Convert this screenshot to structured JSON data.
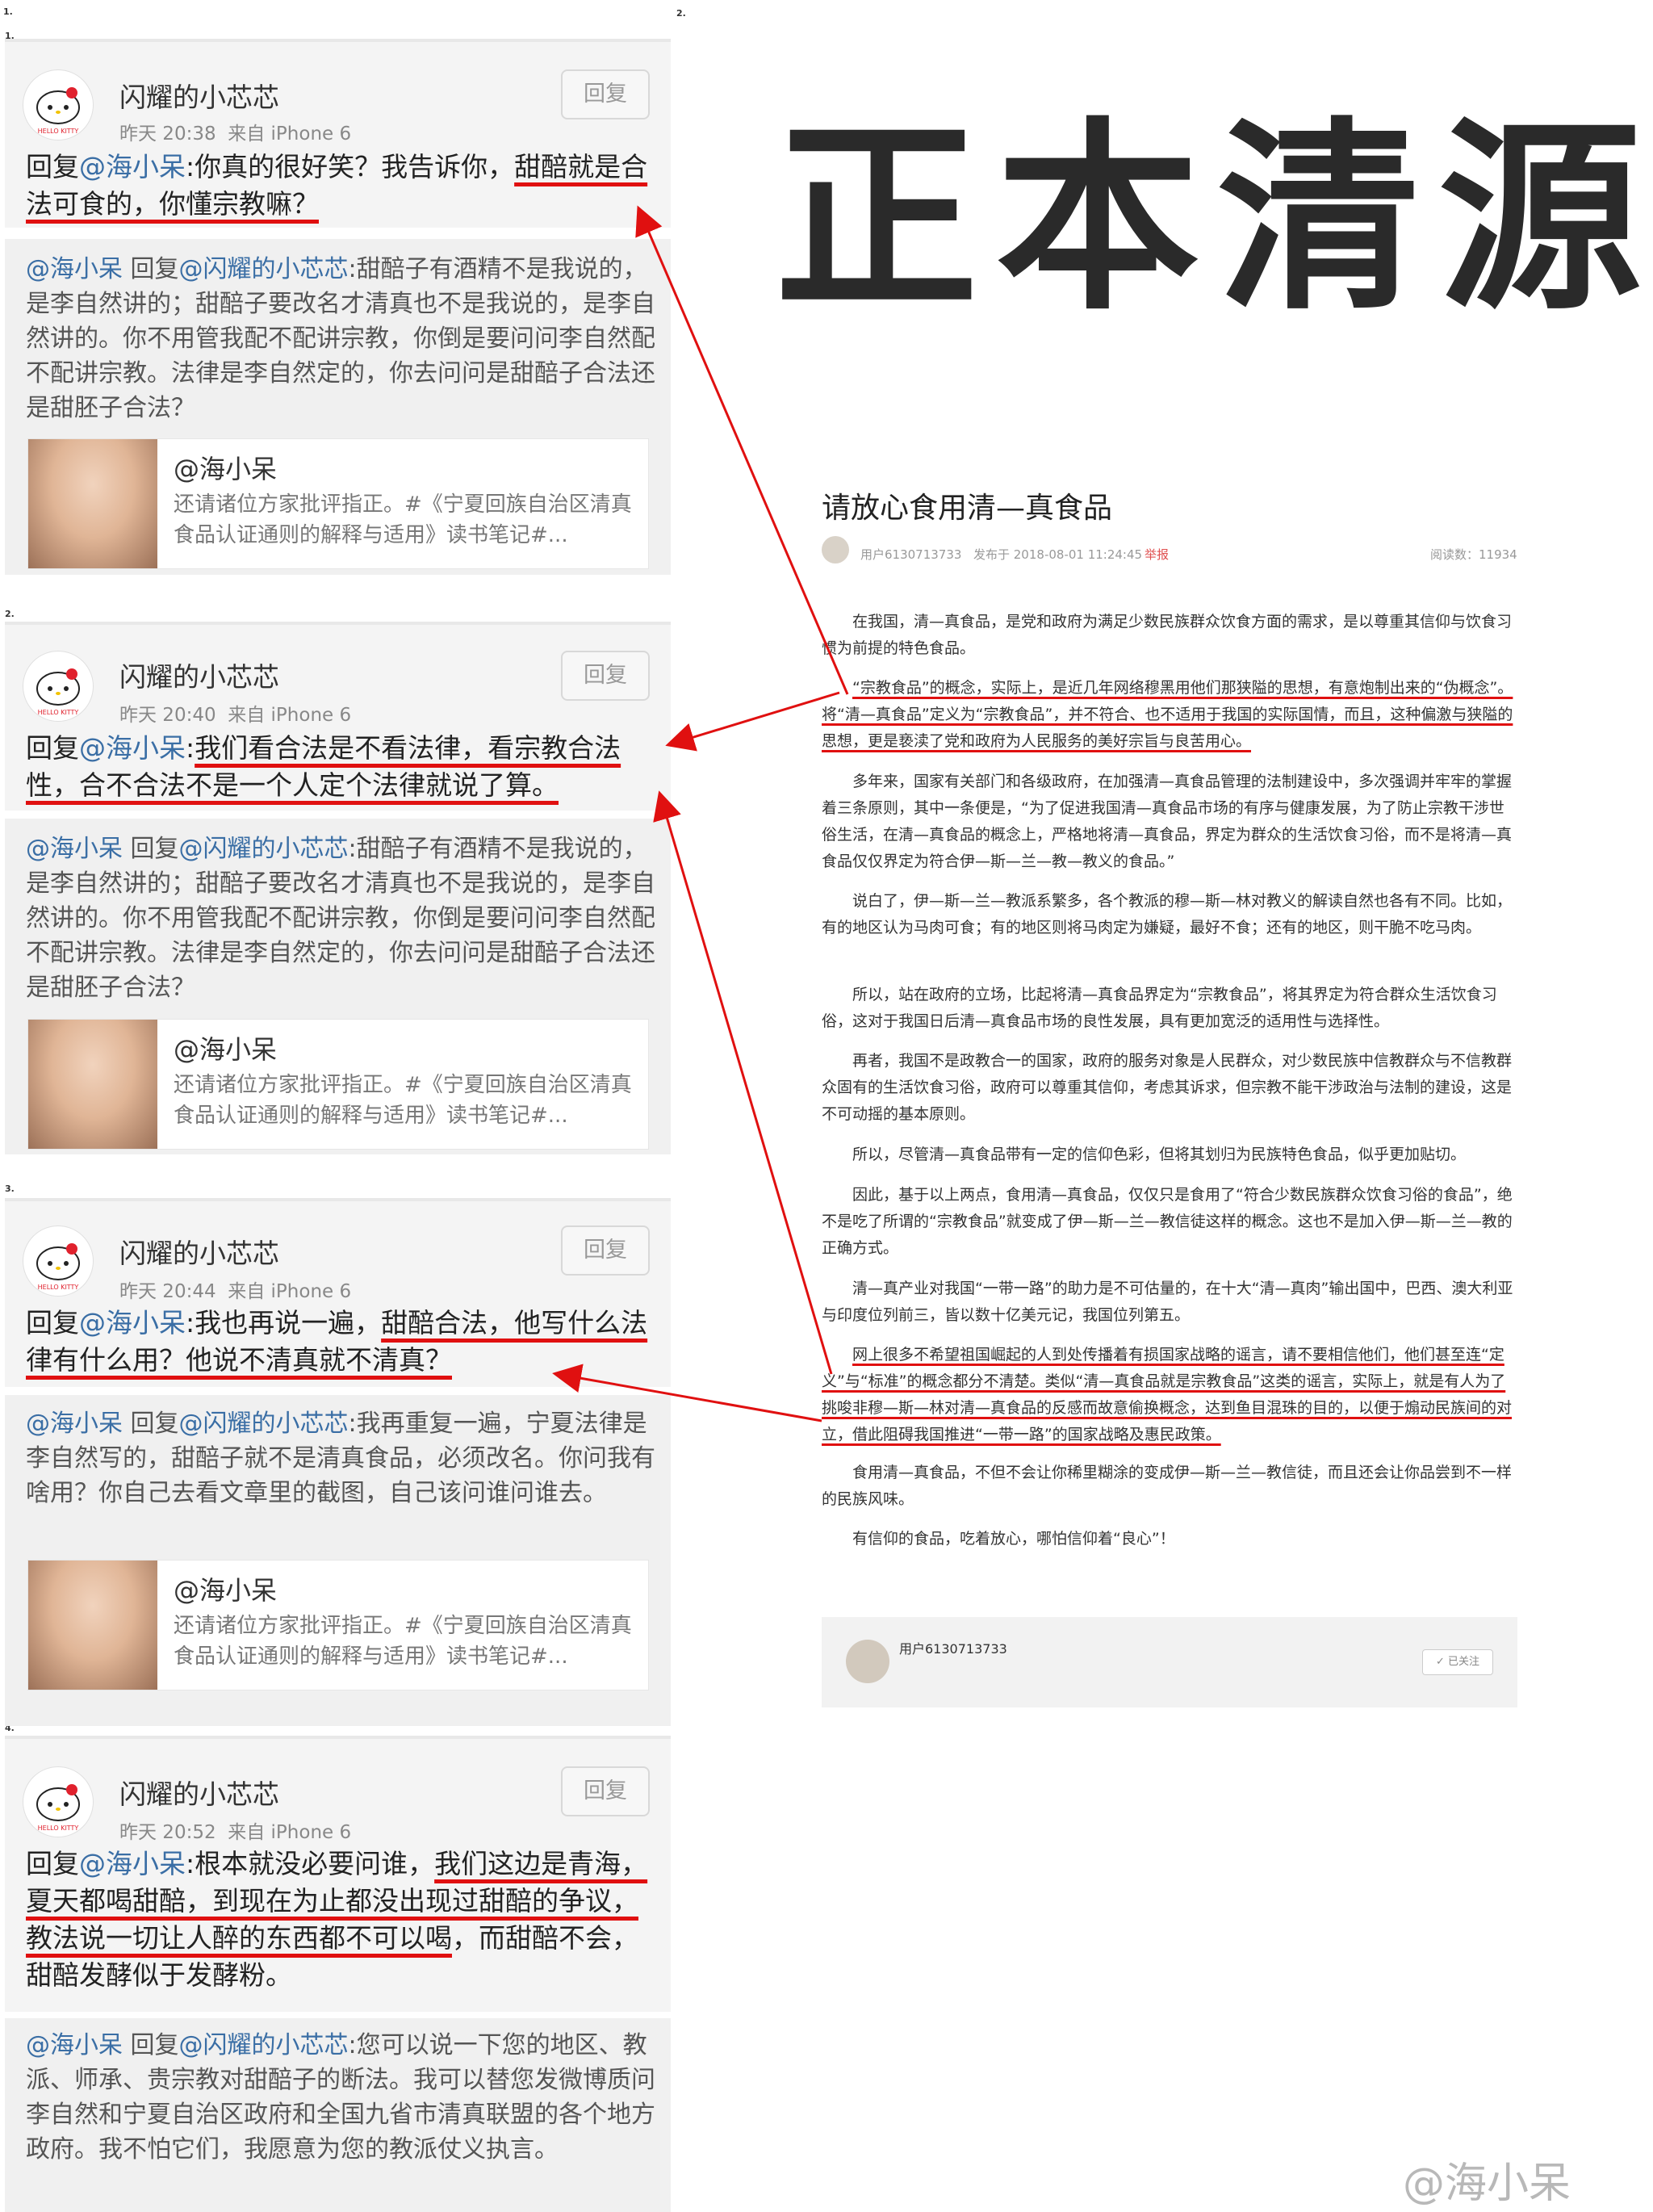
{
  "labels": {
    "n1": "1.",
    "n2": "2.",
    "n1b": "1.",
    "n2b": "2.",
    "n3": "3.",
    "n4": "4."
  },
  "reply_label": "回复",
  "comments": [
    {
      "user": "闪耀的小芯芯",
      "time": "昨天 20:38",
      "source": "来自 iPhone 6",
      "prefix": "回复",
      "mention": "@海小呆",
      "text_a": ":你真的很好笑？我告诉你，",
      "text_u": "甜醅就是合法可食的，你懂宗教嘛？",
      "text_b": "",
      "quote_mention": "@海小呆",
      "quote_reply": " 回复",
      "quote_mention2": "@闪耀的小芯芯",
      "quote_text": ":甜醅子有酒精不是我说的，是李自然讲的；甜醅子要改名才清真也不是我说的，是李自然讲的。你不用管我配不配讲宗教，你倒是要问问李自然配不配讲宗教。法律是李自然定的，你去问问是甜醅子合法还是甜胚子合法？",
      "card_title": "@海小呆",
      "card_desc": "还请诸位方家批评指正。#《宁夏回族自治区清真食品认证通则的解释与适用》读书笔记#..."
    },
    {
      "user": "闪耀的小芯芯",
      "time": "昨天 20:40",
      "source": "来自 iPhone 6",
      "prefix": "回复",
      "mention": "@海小呆",
      "text_a": ":",
      "text_u": "我们看合法是不看法律，看宗教合法性，合不合法不是一个人定个法律就说了算。",
      "text_b": "",
      "quote_mention": "@海小呆",
      "quote_reply": " 回复",
      "quote_mention2": "@闪耀的小芯芯",
      "quote_text": ":甜醅子有酒精不是我说的，是李自然讲的；甜醅子要改名才清真也不是我说的，是李自然讲的。你不用管我配不配讲宗教，你倒是要问问李自然配不配讲宗教。法律是李自然定的，你去问问是甜醅子合法还是甜胚子合法？",
      "card_title": "@海小呆",
      "card_desc": "还请诸位方家批评指正。#《宁夏回族自治区清真食品认证通则的解释与适用》读书笔记#..."
    },
    {
      "user": "闪耀的小芯芯",
      "time": "昨天 20:44",
      "source": "来自 iPhone 6",
      "prefix": "回复",
      "mention": "@海小呆",
      "text_a": ":我也再说一遍，",
      "text_u": "甜醅合法，他写什么法律有什么用？他说不清真就不清真？",
      "text_b": "",
      "quote_mention": "@海小呆",
      "quote_reply": " 回复",
      "quote_mention2": "@闪耀的小芯芯",
      "quote_text": ":我再重复一遍，宁夏法律是李自然写的，甜醅子就不是清真食品，必须改名。你问我有啥用？你自己去看文章里的截图，自己该问谁问谁去。",
      "card_title": "@海小呆",
      "card_desc": "还请诸位方家批评指正。#《宁夏回族自治区清真食品认证通则的解释与适用》读书笔记#..."
    },
    {
      "user": "闪耀的小芯芯",
      "time": "昨天 20:52",
      "source": "来自 iPhone 6",
      "prefix": "回复",
      "mention": "@海小呆",
      "text_a": ":根本就没必要问谁，",
      "text_u": "我们这边是青海，夏天都喝甜醅，到现在为止都没出现过甜醅的争议，教法说一切让人醉的东西都不可以喝",
      "text_b": "，而甜醅不会，甜醅发酵似于发酵粉。",
      "quote_mention": "@海小呆",
      "quote_reply": " 回复",
      "quote_mention2": "@闪耀的小芯芯",
      "quote_text": ":您可以说一下您的地区、教派、师承、贵宗教对甜醅子的断法。我可以替您发微博质问李自然和宁夏自治区政府和全国九省市清真联盟的各个地方政府。我不怕它们，我愿意为您的教派仗义执言。"
    }
  ],
  "article": {
    "banner": "正本清源",
    "title": "请放心食用清—真食品",
    "author": "用户6130713733",
    "published": "发布于 2018-08-01 11:24:45",
    "report": "举报",
    "reads": "阅读数：11934",
    "p1": "在我国，清—真食品，是党和政府为满足少数民族群众饮食方面的需求，是以尊重其信仰与饮食习惯为前提的特色食品。",
    "p2a": "“宗教食品”的概念，实际上，是近几年网络穆黑用他们那狭隘的思想，有意炮制出来的“伪概念”。将“清—真食品”定义为“宗教食品”，并不符合、也不适用于我国的实际国情，而且，这种偏激与狭隘的思想，更是亵渎了党和政府为人民服务的美好宗旨与良苦用心。",
    "p3": "多年来，国家有关部门和各级政府，在加强清—真食品管理的法制建设中，多次强调并牢牢的掌握着三条原则，其中一条便是，“为了促进我国清—真食品市场的有序与健康发展，为了防止宗教干涉世俗生活，在清—真食品的概念上，严格地将清—真食品，界定为群众的生活饮食习俗，而不是将清—真食品仅仅界定为符合伊—斯—兰—教—教义的食品。”",
    "p4": "说白了，伊—斯—兰—教派系繁多，各个教派的穆—斯—林对教义的解读自然也各有不同。比如，有的地区认为马肉可食；有的地区则将马肉定为嫌疑，最好不食；还有的地区，则干脆不吃马肉。",
    "p5": "所以，站在政府的立场，比起将清—真食品界定为“宗教食品”，将其界定为符合群众生活饮食习俗，这对于我国日后清—真食品市场的良性发展，具有更加宽泛的适用性与选择性。",
    "p6": "再者，我国不是政教合一的国家，政府的服务对象是人民群众，对少数民族中信教群众与不信教群众固有的生活饮食习俗，政府可以尊重其信仰，考虑其诉求，但宗教不能干涉政治与法制的建设，这是不可动摇的基本原则。",
    "p7": "所以，尽管清—真食品带有一定的信仰色彩，但将其划归为民族特色食品，似乎更加贴切。",
    "p8": "因此，基于以上两点，食用清—真食品，仅仅只是食用了“符合少数民族群众饮食习俗的食品”，绝不是吃了所谓的“宗教食品”就变成了伊—斯—兰—教信徒这样的概念。这也不是加入伊—斯—兰—教的正确方式。",
    "p9": "清—真产业对我国“一带一路”的助力是不可估量的，在十大“清—真肉”输出国中，巴西、澳大利亚与印度位列前三，皆以数十亿美元记，我国位列第五。",
    "p10": "网上很多不希望祖国崛起的人到处传播着有损国家战略的谣言，请不要相信他们，他们甚至连“定义”与“标准”的概念都分不清楚。类似“清—真食品就是宗教食品”这类的谣言，实际上，就是有人为了挑唆非穆—斯—林对清—真食品的反感而故意偷换概念，达到鱼目混珠的目的，以便于煽动民族间的对立，借此阻碍我国推进“一带一路”的国家战略及惠民政策。",
    "p11": "食用清—真食品，不但不会让你稀里糊涂的变成伊—斯—兰—教信徒，而且还会让你品尝到不一样的民族风味。",
    "p12": "有信仰的食品，吃着放心，哪怕信仰着“良心”！",
    "follow_user": "用户6130713733",
    "follow_btn": "✓ 已关注"
  },
  "watermark": "@海小呆",
  "colors": {
    "accent_red": "#e01010",
    "mention_blue": "#3a6ea5"
  }
}
